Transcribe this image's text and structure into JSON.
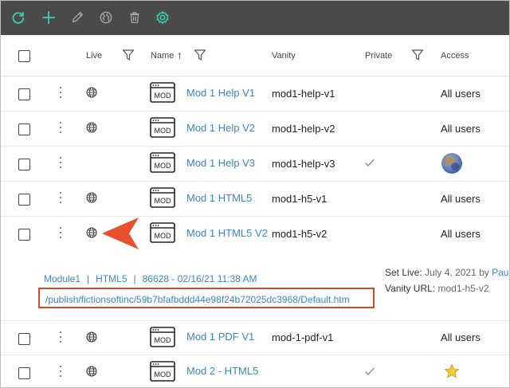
{
  "toolbar": {
    "icons": [
      "refresh-icon",
      "add-icon",
      "edit-pencil-icon",
      "publish-globe-icon",
      "trash-icon",
      "settings-gear-icon"
    ],
    "icon_color": "#3ecfb0",
    "background": "#4a4a4a"
  },
  "table": {
    "headers": {
      "live": "Live",
      "name": "Name",
      "vanity": "Vanity",
      "private": "Private",
      "access": "Access"
    },
    "sort_indicator": "↑",
    "rows": [
      {
        "name": "Mod 1 Help V1",
        "vanity": "mod1-help-v1",
        "private": false,
        "access": "All users",
        "access_type": "text"
      },
      {
        "name": "Mod 1 Help V2",
        "vanity": "mod1-help-v2",
        "private": false,
        "access": "All users",
        "access_type": "text"
      },
      {
        "name": "Mod 1 Help V3",
        "vanity": "mod1-help-v3",
        "private": true,
        "access": "",
        "access_type": "avatar"
      },
      {
        "name": "Mod 1 HTML5",
        "vanity": "mod1-h5-v1",
        "private": false,
        "access": "All users",
        "access_type": "text"
      },
      {
        "name": "Mod 1 HTML5 V2",
        "vanity": "mod1-h5-v2",
        "private": false,
        "access": "All users",
        "access_type": "text"
      },
      {
        "name": "Mod 1 PDF V1",
        "vanity": "mod-1-pdf-v1",
        "private": false,
        "access": "All users",
        "access_type": "text"
      },
      {
        "name": "Mod 2 - HTML5",
        "vanity": "",
        "private": true,
        "access": "",
        "access_type": "star"
      }
    ],
    "mod_icon_label": "MOD"
  },
  "detail": {
    "project": "Module1",
    "target": "HTML5",
    "build": "86628 - 02/16/21 11:38 AM",
    "separator": "|",
    "url": "/publish/fictionsoftinc/59b7bfafbddd44e98f24b72025dc3968/Default.htm",
    "set_live_label": "Set Live:",
    "set_live_value": "July 4, 2021 by",
    "set_live_by": "Pau",
    "vanity_url_label": "Vanity URL:",
    "vanity_url_value": "mod1-h5-v2"
  },
  "colors": {
    "link": "#3a86c8",
    "callout_red": "#d4482b",
    "arrow_orange": "#e8512f"
  }
}
